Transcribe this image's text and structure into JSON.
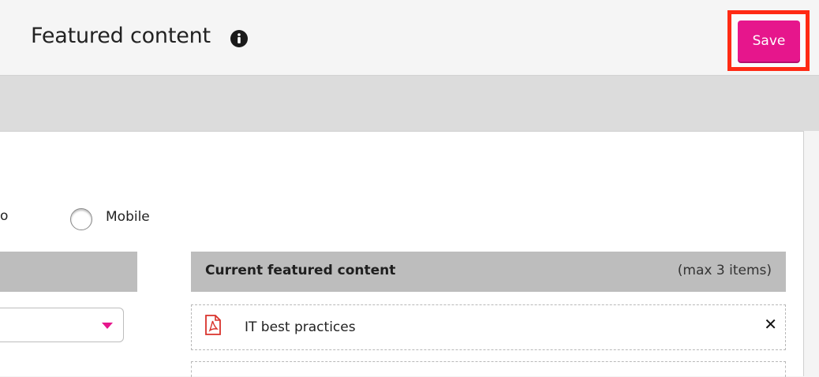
{
  "header": {
    "title": "Featured content",
    "info_icon": "info-circle-icon",
    "save_label": "Save"
  },
  "colors": {
    "accent": "#e6168c",
    "highlight": "#ff2a14"
  },
  "view_options": {
    "cut_label": "o",
    "mobile_label": "Mobile"
  },
  "featured": {
    "title": "Current featured content",
    "max_label": "(max 3 items)",
    "items": [
      {
        "label": "IT best practices",
        "icon": "pdf-file-icon"
      }
    ]
  }
}
